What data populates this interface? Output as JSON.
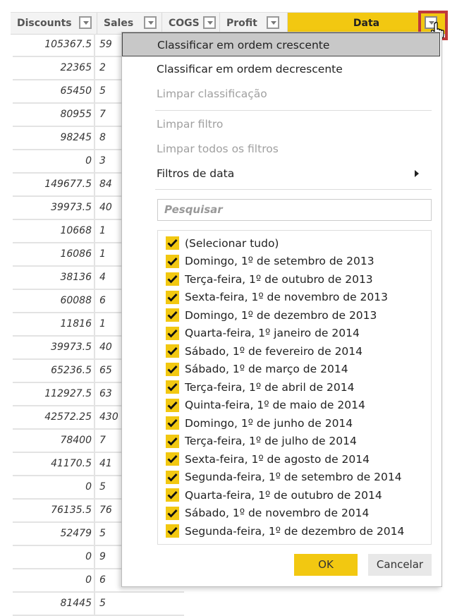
{
  "table": {
    "columns": [
      {
        "label": "Discounts"
      },
      {
        "label": "Sales"
      },
      {
        "label": "COGS"
      },
      {
        "label": "Profit"
      },
      {
        "label": "Data",
        "active": true
      }
    ],
    "rows": [
      {
        "discounts": "105367.5",
        "sales": "59"
      },
      {
        "discounts": "22365",
        "sales": "2"
      },
      {
        "discounts": "65450",
        "sales": "5"
      },
      {
        "discounts": "80955",
        "sales": "7"
      },
      {
        "discounts": "98245",
        "sales": "8"
      },
      {
        "discounts": "0",
        "sales": "3"
      },
      {
        "discounts": "149677.5",
        "sales": "84"
      },
      {
        "discounts": "39973.5",
        "sales": "40"
      },
      {
        "discounts": "10668",
        "sales": "1"
      },
      {
        "discounts": "16086",
        "sales": "1"
      },
      {
        "discounts": "38136",
        "sales": "4"
      },
      {
        "discounts": "60088",
        "sales": "6"
      },
      {
        "discounts": "11816",
        "sales": "1"
      },
      {
        "discounts": "39973.5",
        "sales": "40"
      },
      {
        "discounts": "65236.5",
        "sales": "65"
      },
      {
        "discounts": "112927.5",
        "sales": "63"
      },
      {
        "discounts": "42572.25",
        "sales": "430"
      },
      {
        "discounts": "78400",
        "sales": "7"
      },
      {
        "discounts": "41170.5",
        "sales": "41"
      },
      {
        "discounts": "0",
        "sales": "5"
      },
      {
        "discounts": "76135.5",
        "sales": "76"
      },
      {
        "discounts": "52479",
        "sales": "5"
      },
      {
        "discounts": "0",
        "sales": "9"
      },
      {
        "discounts": "0",
        "sales": "6"
      },
      {
        "discounts": "81445",
        "sales": "5"
      }
    ]
  },
  "menu": {
    "items": [
      {
        "label": "Classificar em ordem crescente",
        "state": "highlighted"
      },
      {
        "label": "Classificar em ordem decrescente",
        "state": "enabled"
      },
      {
        "label": "Limpar classificação",
        "state": "disabled"
      },
      {
        "label": "Limpar filtro",
        "state": "disabled"
      },
      {
        "label": "Limpar todos os filtros",
        "state": "disabled"
      },
      {
        "label": "Filtros de data",
        "state": "submenu"
      }
    ],
    "search_placeholder": "Pesquisar",
    "options": [
      "(Selecionar tudo)",
      "Domingo, 1º de setembro de 2013",
      "Terça-feira, 1º de outubro de 2013",
      "Sexta-feira, 1º de novembro de 2013",
      "Domingo, 1º de dezembro de 2013",
      "Quarta-feira, 1º janeiro de 2014",
      "Sábado, 1º de fevereiro de 2014",
      "Sábado, 1º de março de 2014",
      "Terça-feira, 1º de abril de 2014",
      "Quinta-feira, 1º de maio de 2014",
      "Domingo, 1º de junho de 2014",
      "Terça-feira, 1º de julho de 2014",
      "Sexta-feira, 1º de agosto de 2014",
      "Segunda-feira, 1º de setembro de 2014",
      "Quarta-feira, 1º de outubro de 2014",
      "Sábado, 1º de novembro de 2014",
      "Segunda-feira, 1º de dezembro de 2014"
    ],
    "all_checked": true,
    "ok_label": "OK",
    "cancel_label": "Cancelar"
  },
  "colors": {
    "accent": "#f2c811",
    "highlight_box": "#c0393b",
    "hover": "#c8c8c8"
  }
}
